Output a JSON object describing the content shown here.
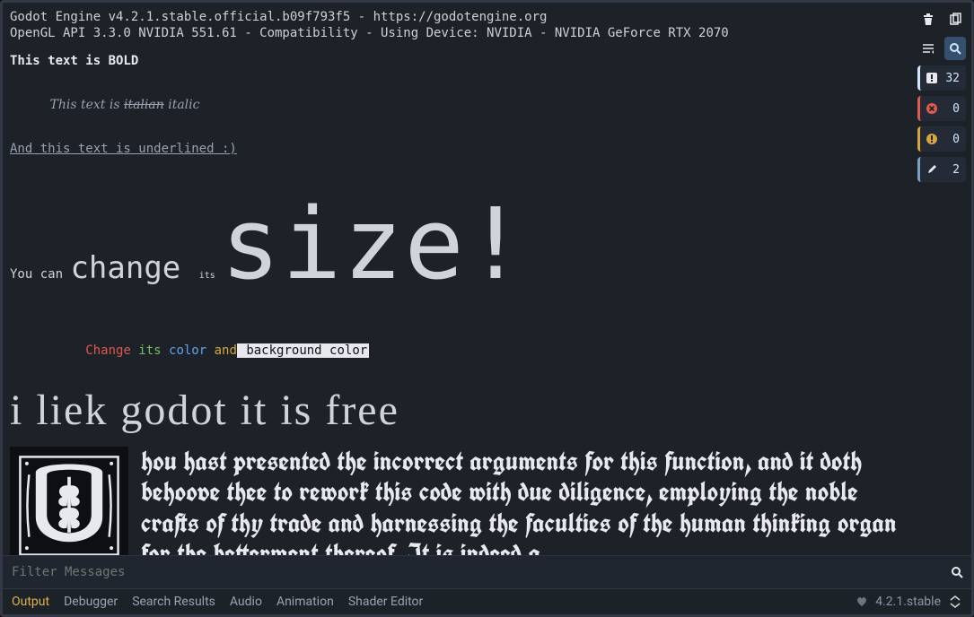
{
  "log": {
    "line1": "Godot Engine v4.2.1.stable.official.b09f793f5 - https://godotengine.org",
    "line2": "OpenGL API 3.3.0 NVIDIA 551.61 - Compatibility - Using Device: NVIDIA - NVIDIA GeForce RTX 2070",
    "bold": "This text is BOLD",
    "italic_pre": "This text is ",
    "italic_strike": "italian",
    "italic_post": " italic",
    "underline": "And this text is underlined :)",
    "size_p1": "You can ",
    "size_p2": "change ",
    "size_p3": "its ",
    "size_p4": "size!",
    "c_red": "Change",
    "c_green": " its",
    "c_blue": " color",
    "c_yellow": " and",
    "c_bg": " background color",
    "hand": "i liek godot it is free",
    "black": "hou hast presented the incorrect arguments for this function, and it doth behoove thee to rework this code with due diligence, employing the noble crafts of thy trade and harnessing the faculties of the human thinking organ for the betterment thereof. It is indeed a"
  },
  "sidebar": {
    "info_count": "32",
    "error_count": "0",
    "warn_count": "0",
    "edit_count": "2"
  },
  "filter": {
    "placeholder": "Filter Messages"
  },
  "tabs": {
    "output": "Output",
    "debugger": "Debugger",
    "search": "Search Results",
    "audio": "Audio",
    "animation": "Animation",
    "shader": "Shader Editor"
  },
  "status": {
    "version": "4.2.1.stable"
  }
}
